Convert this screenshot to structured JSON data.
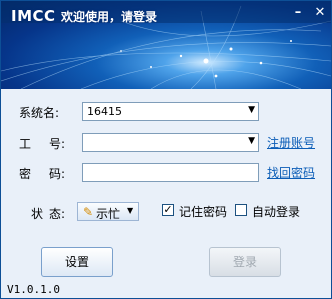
{
  "window": {
    "logo": "IMCC",
    "title": "欢迎使用，请登录",
    "minimize_icon": "minimize-icon",
    "close_icon": "close-icon"
  },
  "form": {
    "system_label": "系统名:",
    "system_value": "16415",
    "worker_label_1": "工",
    "worker_label_2": "号:",
    "worker_value": "",
    "register_link": "注册账号",
    "password_label_1": "密",
    "password_label_2": "码:",
    "password_value": "",
    "recover_link": "找回密码"
  },
  "status": {
    "label_1": "状",
    "label_2": "态:",
    "value": "示忙",
    "icon": "pencil-icon"
  },
  "options": {
    "remember_password": {
      "label": "记住密码",
      "checked": true
    },
    "auto_login": {
      "label": "自动登录",
      "checked": false
    }
  },
  "buttons": {
    "settings": "设置",
    "login": "登录"
  },
  "footer": {
    "version": "V1.0.1.0"
  },
  "colors": {
    "banner_dark": "#032563",
    "banner_light": "#4fa3ea",
    "link": "#0b5db7",
    "border": "#0d4f96"
  }
}
